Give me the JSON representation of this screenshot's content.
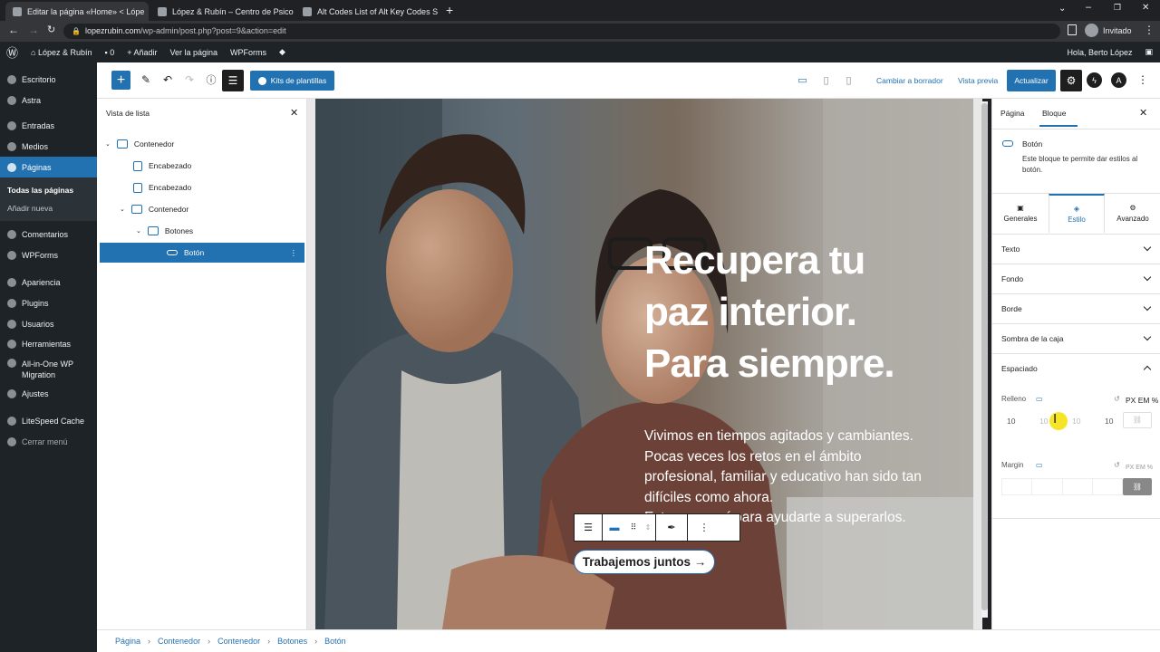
{
  "browser": {
    "tabs": [
      {
        "title": "Editar la página «Home» < Lópe"
      },
      {
        "title": "López & Rubín – Centro de Psico"
      },
      {
        "title": "Alt Codes List of Alt Key Codes S"
      }
    ],
    "url_domain": "lopezrubin.com",
    "url_path": "/wp-admin/post.php?post=9&action=edit",
    "profile": "Invitado"
  },
  "adminbar": {
    "site": "López & Rubín",
    "comments": "0",
    "add": "Añadir",
    "view": "Ver la página",
    "wpforms": "WPForms",
    "greeting": "Hola, Berto López"
  },
  "sidebar": {
    "items": [
      {
        "label": "Escritorio"
      },
      {
        "label": "Astra"
      },
      {
        "label": "Entradas"
      },
      {
        "label": "Medios"
      },
      {
        "label": "Páginas"
      },
      {
        "label": "Comentarios"
      },
      {
        "label": "WPForms"
      },
      {
        "label": "Apariencia"
      },
      {
        "label": "Plugins"
      },
      {
        "label": "Usuarios"
      },
      {
        "label": "Herramientas"
      },
      {
        "label": "All-in-One WP Migration"
      },
      {
        "label": "Ajustes"
      },
      {
        "label": "LiteSpeed Cache"
      },
      {
        "label": "Cerrar menú"
      }
    ],
    "sub": {
      "all": "Todas las páginas",
      "new": "Añadir nueva"
    }
  },
  "toolbar": {
    "kits": "Kits de plantillas",
    "draft": "Cambiar a borrador",
    "preview": "Vista previa",
    "update": "Actualizar"
  },
  "listview": {
    "title": "Vista de lista",
    "rows": [
      {
        "label": "Contenedor"
      },
      {
        "label": "Encabezado"
      },
      {
        "label": "Encabezado"
      },
      {
        "label": "Contenedor"
      },
      {
        "label": "Botones"
      },
      {
        "label": "Botón"
      }
    ]
  },
  "hero": {
    "heading": [
      "Recupera tu",
      "paz interior.",
      "Para siempre."
    ],
    "body": [
      "Vivimos en tiempos agitados y cambiantes.",
      "Pocas veces los retos en el ámbito",
      "profesional, familiar y educativo han sido tan",
      "difíciles como ahora.",
      "Estamos aquí para ayudarte a superarlos."
    ],
    "button": "Trabajemos juntos →"
  },
  "rpanel": {
    "tab_page": "Página",
    "tab_block": "Bloque",
    "block_name": "Botón",
    "block_desc": "Este bloque te permite dar estilos al botón.",
    "tabs": [
      "Generales",
      "Estilo",
      "Avanzado"
    ],
    "sections": [
      "Texto",
      "Fondo",
      "Borde",
      "Sombra de la caja",
      "Espaciado"
    ],
    "padding_label": "Relleno",
    "padding_values": [
      "10",
      "10",
      "10",
      "10"
    ],
    "units": "PX EM %",
    "margin_label": "Margin"
  },
  "breadcrumb": [
    "Página",
    "Contenedor",
    "Contenedor",
    "Botones",
    "Botón"
  ]
}
